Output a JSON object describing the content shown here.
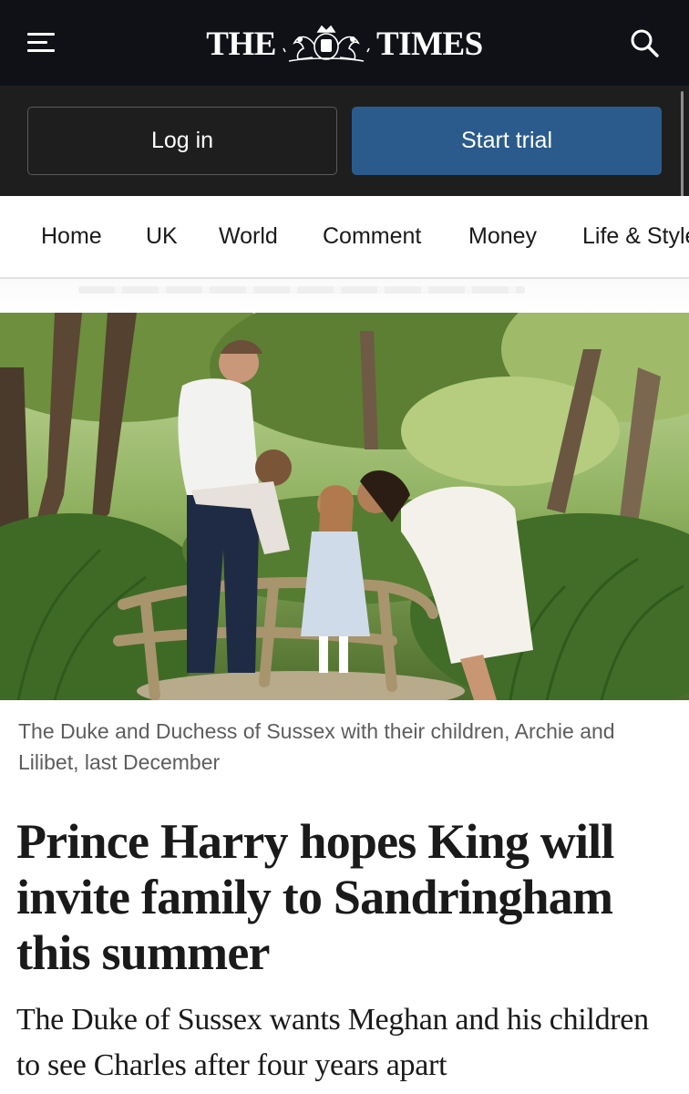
{
  "masthead": {
    "word_left": "THE",
    "word_right": "TIMES",
    "menu_icon": "hamburger-menu-icon",
    "search_icon": "search-icon",
    "crest_icon": "royal-crest-icon",
    "background": "#0f1117"
  },
  "account": {
    "login_label": "Log in",
    "trial_label": "Start trial",
    "trial_color": "#2a5b8c",
    "background": "#1e1e1e"
  },
  "nav": {
    "items": [
      "Home",
      "UK",
      "World",
      "Comment",
      "Money",
      "Life & Style"
    ]
  },
  "article": {
    "caption": "The Duke and Duchess of Sussex with their children, Archie and Lilibet, last December",
    "headline": "Prince Harry hopes King will invite family to Sandringham this summer",
    "standfirst": "The Duke of Sussex wants Meghan and his children to see Charles after four years apart"
  }
}
